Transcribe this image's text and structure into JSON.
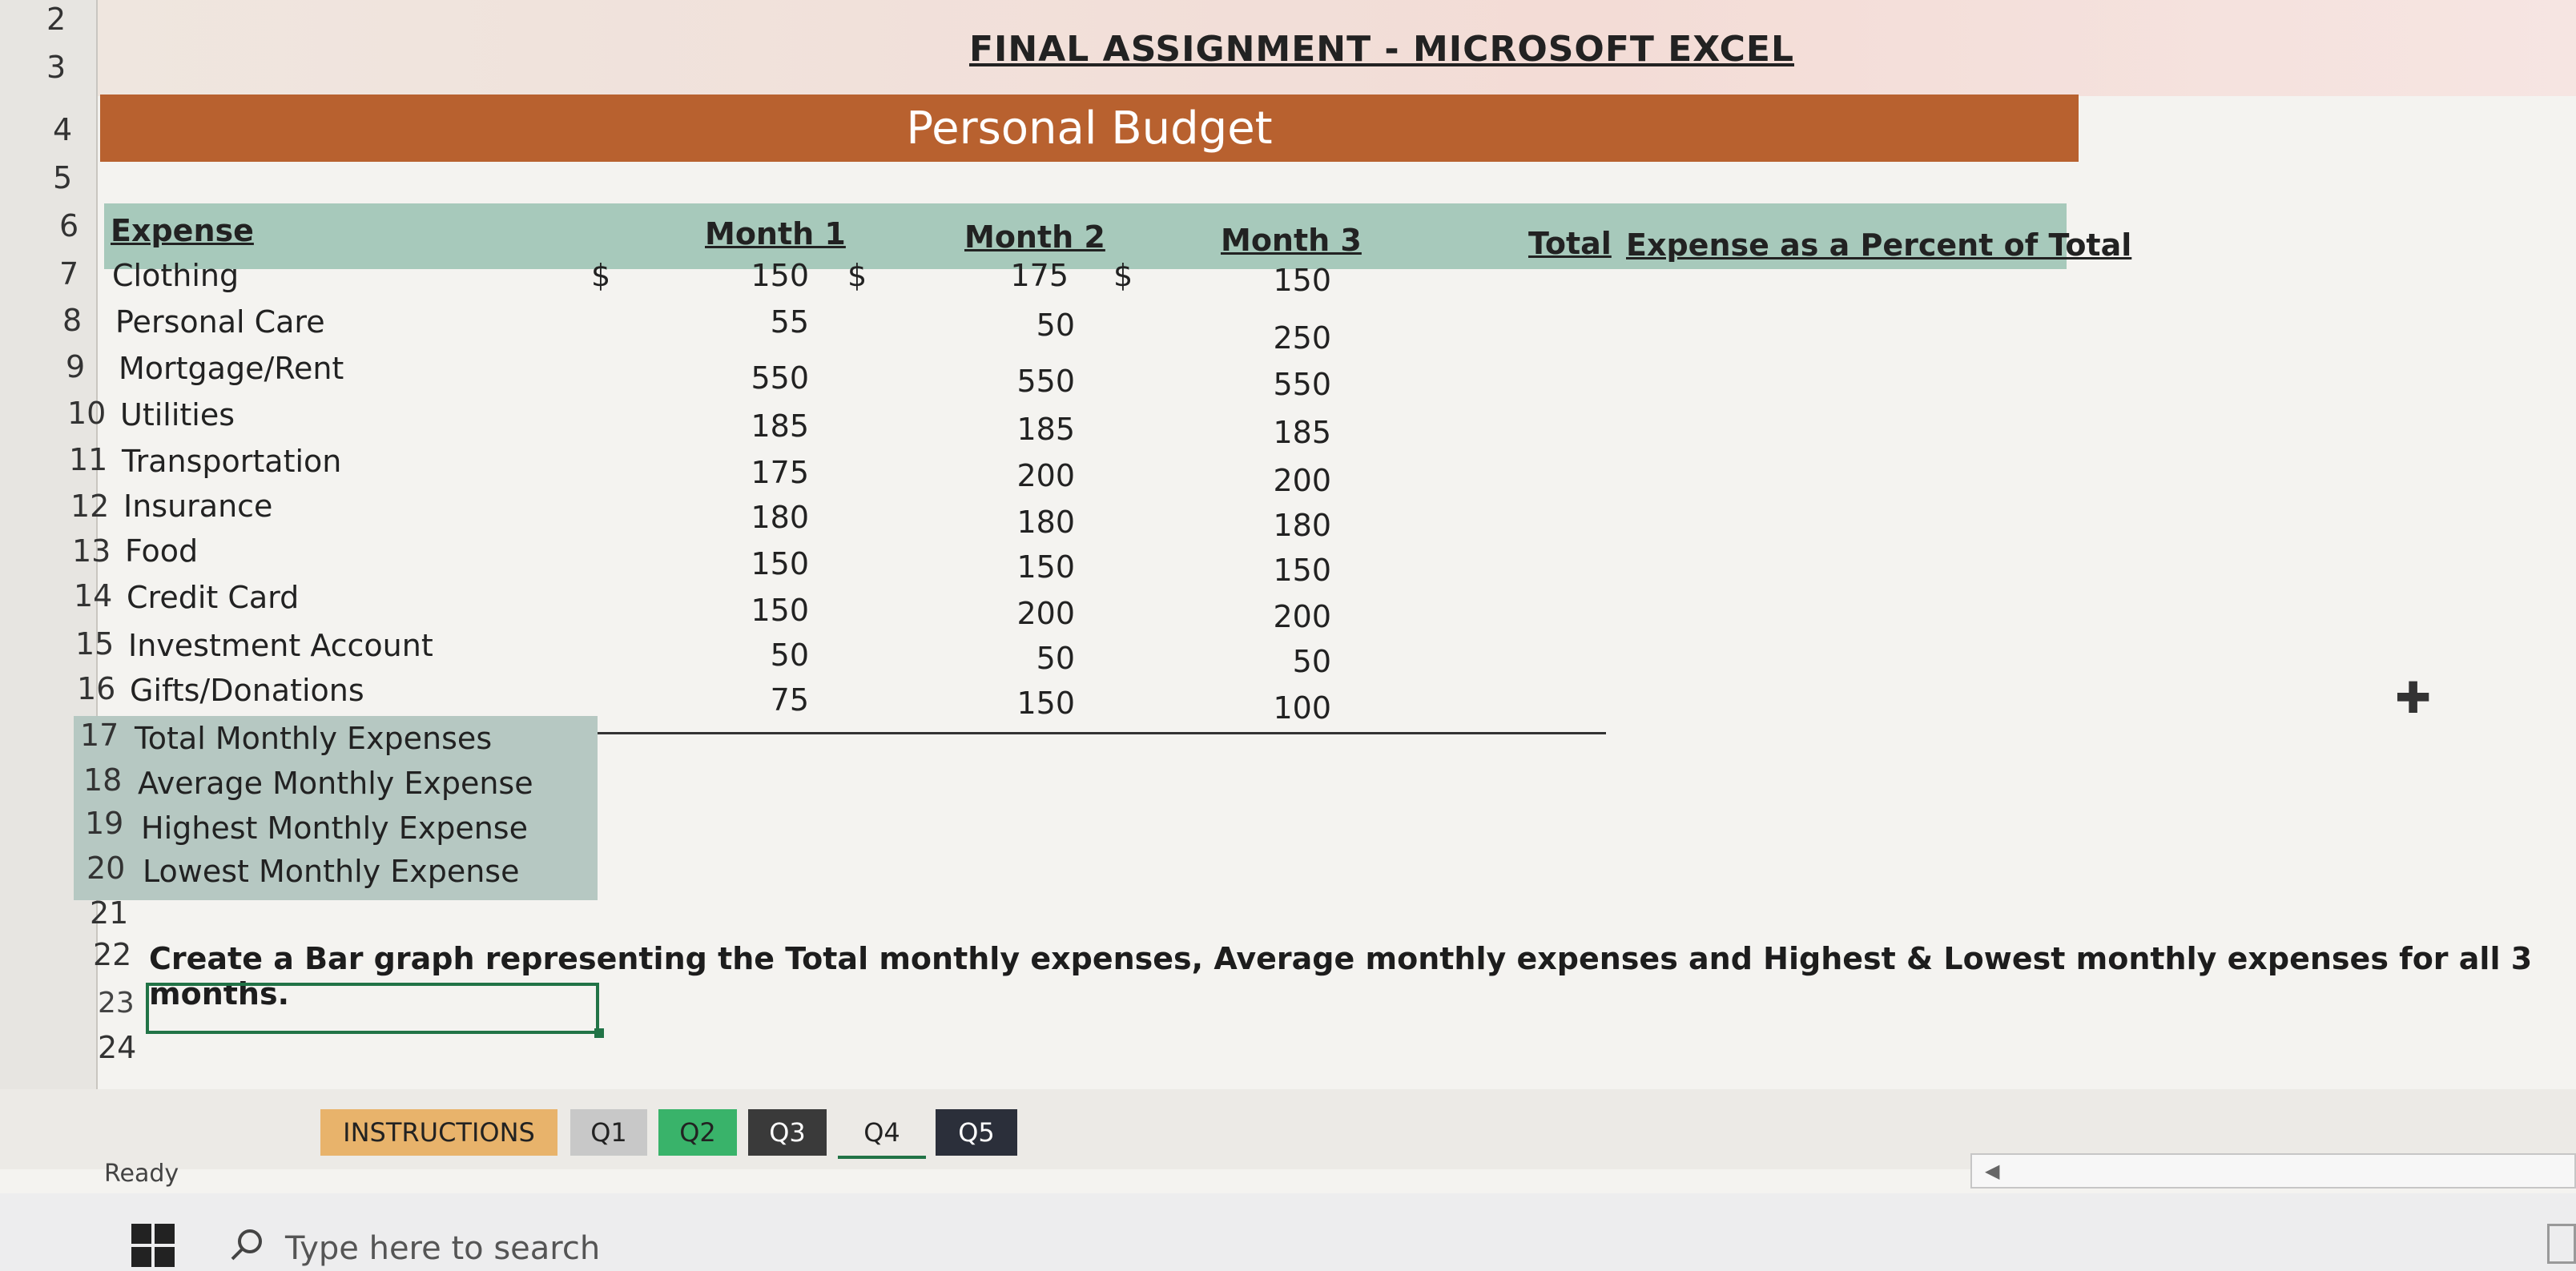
{
  "sheet_title": "FINAL ASSIGNMENT - MICROSOFT EXCEL",
  "banner": "Personal Budget",
  "row_numbers": [
    "2",
    "3",
    "4",
    "5",
    "6",
    "7",
    "8",
    "9",
    "10",
    "11",
    "12",
    "13",
    "14",
    "15",
    "16",
    "17",
    "18",
    "19",
    "20",
    "21",
    "22",
    "23",
    "24"
  ],
  "headers": {
    "expense": "Expense",
    "month1": "Month 1",
    "month2": "Month 2",
    "month3": "Month 3",
    "total": "Total",
    "percent": "Expense as a Percent of Total"
  },
  "currency_symbol": "$",
  "expenses": [
    {
      "name": "Clothing",
      "m1": "150",
      "m2": "175",
      "m3": "150"
    },
    {
      "name": "Personal Care",
      "m1": "55",
      "m2": "50",
      "m3": "250"
    },
    {
      "name": "Mortgage/Rent",
      "m1": "550",
      "m2": "550",
      "m3": "550"
    },
    {
      "name": "Utilities",
      "m1": "185",
      "m2": "185",
      "m3": "185"
    },
    {
      "name": "Transportation",
      "m1": "175",
      "m2": "200",
      "m3": "200"
    },
    {
      "name": "Insurance",
      "m1": "180",
      "m2": "180",
      "m3": "180"
    },
    {
      "name": "Food",
      "m1": "150",
      "m2": "150",
      "m3": "150"
    },
    {
      "name": "Credit Card",
      "m1": "150",
      "m2": "200",
      "m3": "200"
    },
    {
      "name": "Investment Account",
      "m1": "50",
      "m2": "50",
      "m3": "50"
    },
    {
      "name": "Gifts/Donations",
      "m1": "75",
      "m2": "150",
      "m3": "100"
    }
  ],
  "summary": [
    "Total Monthly Expenses",
    "Average Monthly Expense",
    "Highest Monthly Expense",
    "Lowest Monthly Expense"
  ],
  "instruction": "Create a Bar graph representing the Total monthly expenses, Average monthly expenses and Highest & Lowest monthly expenses for all 3 months.",
  "tabs": [
    {
      "label": "INSTRUCTIONS",
      "bg": "#e8b36b"
    },
    {
      "label": "Q1",
      "bg": "#c8c8c8"
    },
    {
      "label": "Q2",
      "bg": "#39b36a"
    },
    {
      "label": "Q3",
      "bg": "#3a3a3a"
    },
    {
      "label": "Q4",
      "bg": "#eceae6"
    },
    {
      "label": "Q5",
      "bg": "#2b2f3a"
    }
  ],
  "status": "Ready",
  "taskbar": {
    "search_placeholder": "Type here to search"
  },
  "colors": {
    "banner": "#b8612f",
    "header": "#a7c9bb",
    "summary": "#b6c8c2",
    "selection": "#217346"
  }
}
